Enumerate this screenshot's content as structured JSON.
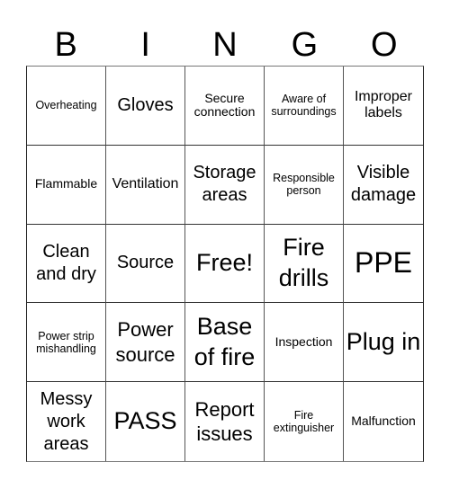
{
  "header": {
    "letters": [
      "B",
      "I",
      "N",
      "G",
      "O"
    ]
  },
  "cells": [
    {
      "text": "Overheating",
      "size": "s-xs"
    },
    {
      "text": "Gloves",
      "size": "s-lg"
    },
    {
      "text": "Secure connection",
      "size": "s-sm"
    },
    {
      "text": "Aware of surroundings",
      "size": "s-xs"
    },
    {
      "text": "Improper labels",
      "size": "s-md"
    },
    {
      "text": "Flammable",
      "size": "s-sm"
    },
    {
      "text": "Ventilation",
      "size": "s-md"
    },
    {
      "text": "Storage areas",
      "size": "s-lg"
    },
    {
      "text": "Responsible person",
      "size": "s-xs"
    },
    {
      "text": "Visible damage",
      "size": "s-lg"
    },
    {
      "text": "Clean and dry",
      "size": "s-lg"
    },
    {
      "text": "Source",
      "size": "s-lg"
    },
    {
      "text": "Free!",
      "size": "s-xxl"
    },
    {
      "text": "Fire drills",
      "size": "s-xxl"
    },
    {
      "text": "PPE",
      "size": "s-huge"
    },
    {
      "text": "Power strip mishandling",
      "size": "s-xs"
    },
    {
      "text": "Power source",
      "size": "s-xl"
    },
    {
      "text": "Base of fire",
      "size": "s-xxl"
    },
    {
      "text": "Inspection",
      "size": "s-sm"
    },
    {
      "text": "Plug in",
      "size": "s-xxl"
    },
    {
      "text": "Messy work areas",
      "size": "s-lg"
    },
    {
      "text": "PASS",
      "size": "s-xxl"
    },
    {
      "text": "Report issues",
      "size": "s-xl"
    },
    {
      "text": "Fire extinguisher",
      "size": "s-xs"
    },
    {
      "text": "Malfunction",
      "size": "s-sm"
    }
  ]
}
